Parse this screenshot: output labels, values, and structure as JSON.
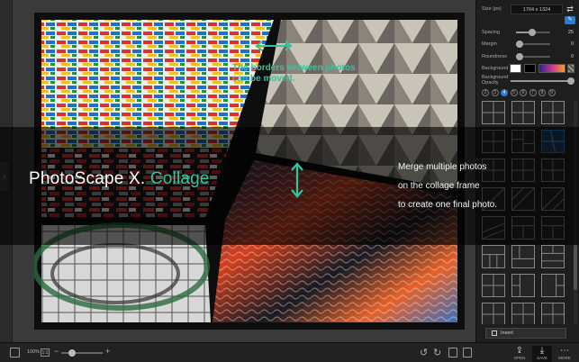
{
  "panel": {
    "size_label": "Size (px)",
    "size_value": "1764 x 1324",
    "rows": [
      {
        "label": "Spacing",
        "value": "25",
        "fraction": 0.42
      },
      {
        "label": "Margin",
        "value": "0",
        "fraction": 0.0
      },
      {
        "label": "Roundness",
        "value": "0",
        "fraction": 0.0
      }
    ],
    "background_label": "Background",
    "background_opacity_label": "Background Opacity",
    "background_opacity_fraction": 1.0,
    "swatch_colors": [
      "#ffffff",
      "#000000",
      "#7a1f8f"
    ],
    "counts": [
      "2",
      "3",
      "4",
      "5",
      "6",
      "7",
      "8",
      "9"
    ],
    "active_count": "4",
    "templates_count": 24,
    "selected_template": 5,
    "insert_label": "Insert"
  },
  "banner": {
    "title_main": "PhotoScape X. ",
    "title_accent": "Collage",
    "lines": [
      "Merge multiple photos",
      "on the collage frame",
      "to create one final photo."
    ]
  },
  "annotation": {
    "text": "The borders between photos can be moved.",
    "accent": "#2ec7a0"
  },
  "bottom": {
    "zoom": "100%",
    "zoom_11": "1:1",
    "zoom_fraction": 0.22,
    "open_label": "OPEN",
    "save_label": "SAVE",
    "more_label": "MORE"
  }
}
